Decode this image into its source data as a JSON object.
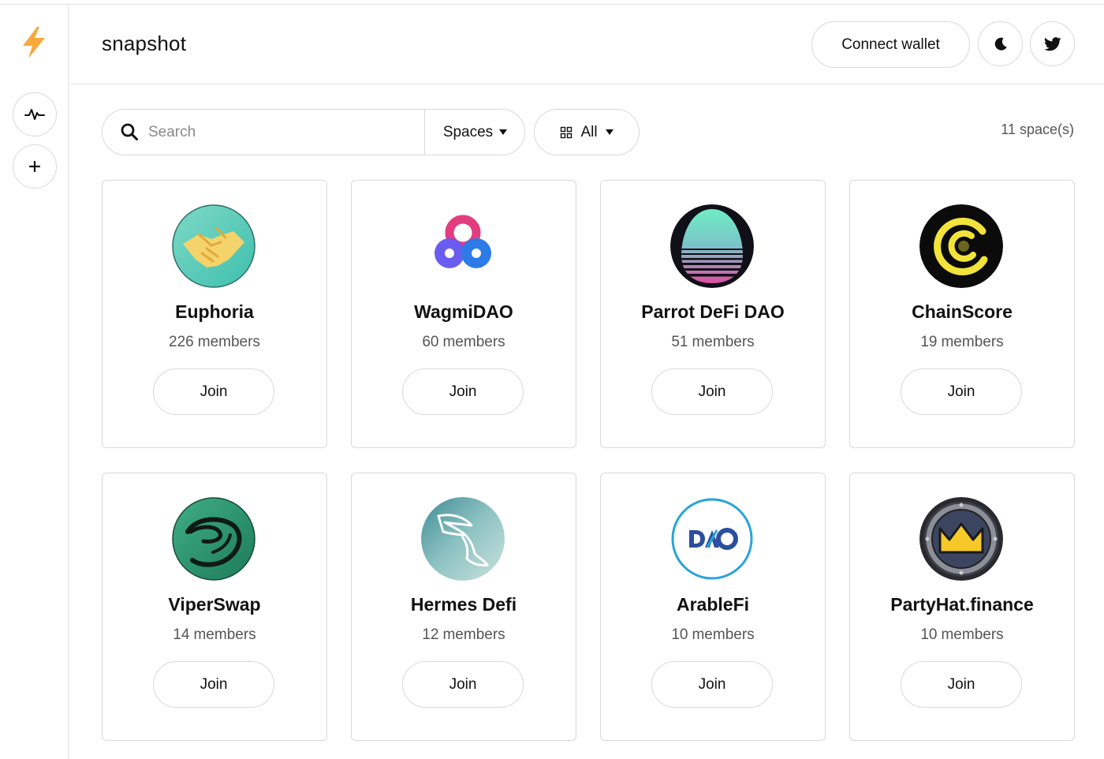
{
  "header": {
    "brand": "snapshot",
    "connect_label": "Connect wallet"
  },
  "sidebar": {
    "logo_icon": "lightning-icon",
    "items": [
      {
        "icon": "activity-icon"
      },
      {
        "icon": "plus-icon"
      }
    ]
  },
  "toolbar": {
    "search_placeholder": "Search",
    "search_value": "",
    "spaces_label": "Spaces",
    "filter_label": "All",
    "space_count": "11 space(s)"
  },
  "colors": {
    "brand_accent": "#F7A93B",
    "border": "#D9D9D9",
    "text_muted": "#555555"
  },
  "spaces": [
    {
      "name": "Euphoria",
      "members": "226",
      "members_label": "members",
      "join_label": "Join",
      "avatar_icon": "handshake-icon"
    },
    {
      "name": "WagmiDAO",
      "members": "60",
      "members_label": "members",
      "join_label": "Join",
      "avatar_icon": "wagmi-logo-icon"
    },
    {
      "name": "Parrot DeFi DAO",
      "members": "51",
      "members_label": "members",
      "join_label": "Join",
      "avatar_icon": "egg-gradient-icon"
    },
    {
      "name": "ChainScore",
      "members": "19",
      "members_label": "members",
      "join_label": "Join",
      "avatar_icon": "chainscore-logo-icon"
    },
    {
      "name": "ViperSwap",
      "members": "14",
      "members_label": "members",
      "join_label": "Join",
      "avatar_icon": "viper-icon"
    },
    {
      "name": "Hermes Defi",
      "members": "12",
      "members_label": "members",
      "join_label": "Join",
      "avatar_icon": "winged-boot-icon"
    },
    {
      "name": "ArableFi",
      "members": "10",
      "members_label": "members",
      "join_label": "Join",
      "avatar_icon": "dao-text-icon"
    },
    {
      "name": "PartyHat.finance",
      "members": "10",
      "members_label": "members",
      "join_label": "Join",
      "avatar_icon": "crown-icon"
    }
  ]
}
